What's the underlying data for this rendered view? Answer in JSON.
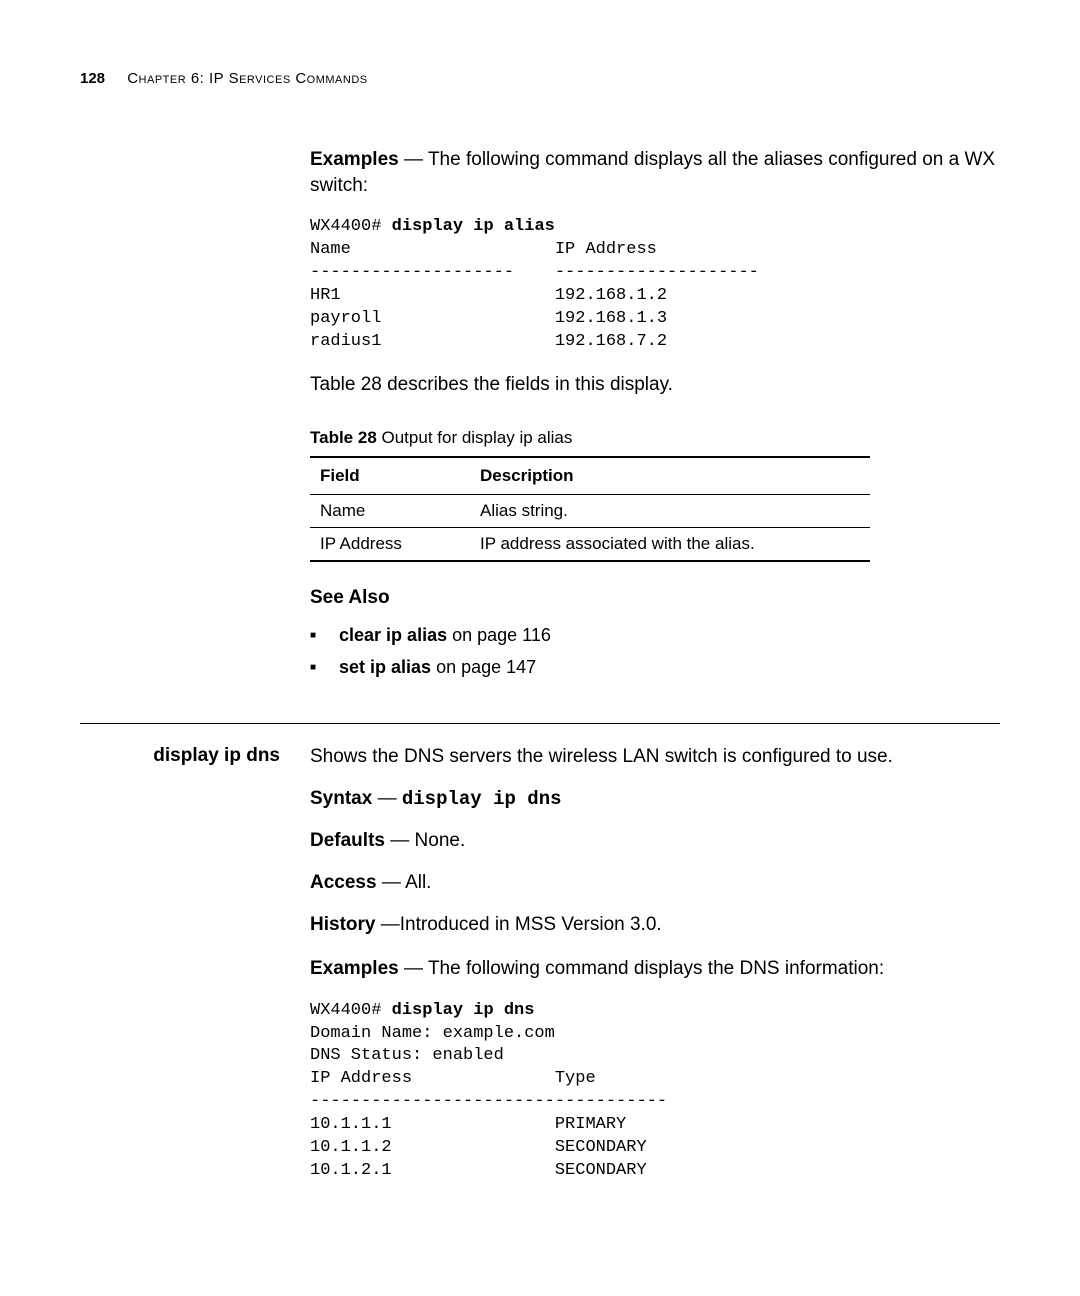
{
  "header": {
    "page_number": "128",
    "chapter_label": "Chapter 6: IP Services Commands"
  },
  "section1": {
    "examples_label": "Examples",
    "examples_text": " — The following command displays all the aliases configured on a WX switch:",
    "cli_prompt": "WX4400# ",
    "cli_bold": "display ip alias",
    "cli_output": "Name                    IP Address\n--------------------    --------------------\nHR1                     192.168.1.2\npayroll                 192.168.1.3\nradius1                 192.168.7.2",
    "table_ref_text": "Table 28 describes the fields in this display.",
    "table_caption_bold": "Table 28",
    "table_caption_rest": "   Output for display ip alias",
    "table": {
      "col1": "Field",
      "col2": "Description",
      "rows": [
        {
          "field": "Name",
          "desc": "Alias string."
        },
        {
          "field": "IP Address",
          "desc": "IP address associated with the alias."
        }
      ]
    },
    "see_also_label": "See Also",
    "see_also": [
      {
        "cmd": "clear ip alias",
        "rest": " on page 116"
      },
      {
        "cmd": "set ip alias",
        "rest": " on page 147"
      }
    ]
  },
  "section2": {
    "side_heading": "display ip dns",
    "intro": "Shows the DNS servers the wireless LAN switch is configured to use.",
    "syntax_label": "Syntax",
    "syntax_dash": " — ",
    "syntax_cmd": "display ip dns",
    "defaults_label": "Defaults",
    "defaults_text": " — None.",
    "access_label": "Access",
    "access_text": " — All.",
    "history_label": "History",
    "history_text": " —Introduced in MSS Version 3.0.",
    "examples_label": "Examples",
    "examples_text": " — The following command displays the DNS information:",
    "cli_prompt": "WX4400# ",
    "cli_bold": "display ip dns",
    "cli_output": "Domain Name: example.com\nDNS Status: enabled\nIP Address              Type\n-----------------------------------\n10.1.1.1                PRIMARY\n10.1.1.2                SECONDARY\n10.1.2.1                SECONDARY"
  }
}
